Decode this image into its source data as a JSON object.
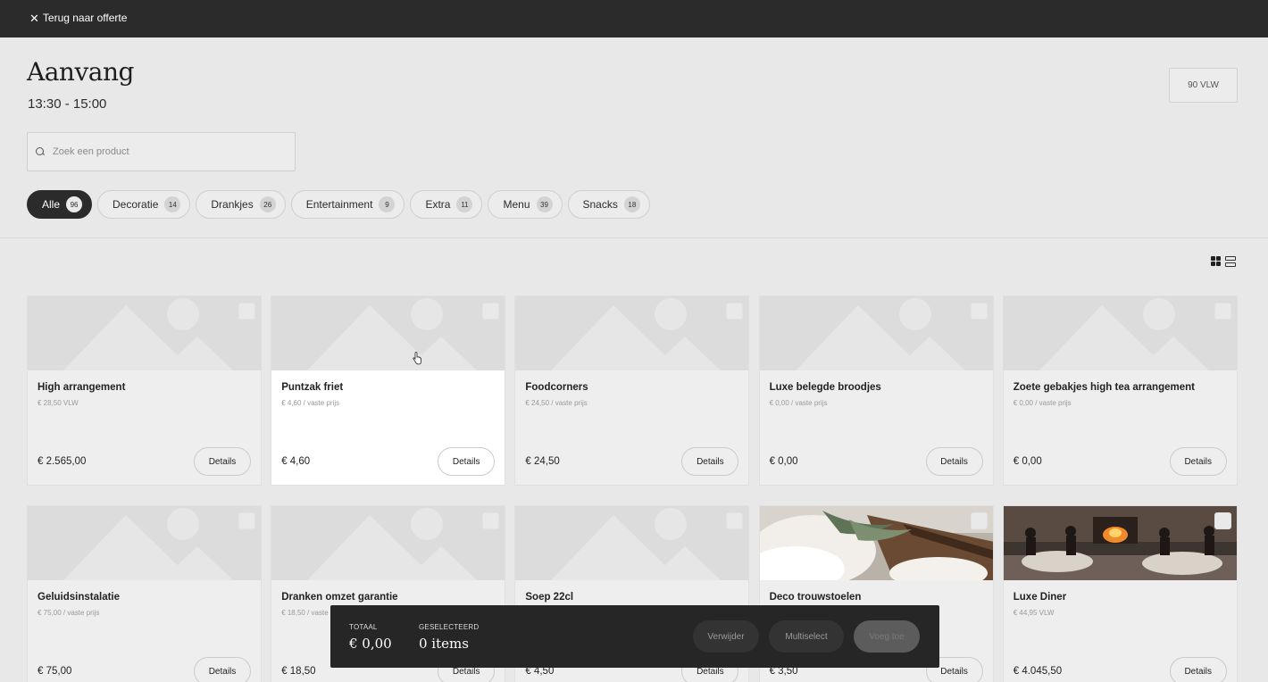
{
  "topbar": {
    "back_label": "Terug naar offerte"
  },
  "header": {
    "title": "Aanvang",
    "time": "13:30 - 15:00",
    "guests": "90 VLW"
  },
  "search": {
    "placeholder": "Zoek een product"
  },
  "filters": [
    {
      "label": "Alle",
      "count": "96",
      "active": true
    },
    {
      "label": "Decoratie",
      "count": "14",
      "active": false
    },
    {
      "label": "Drankjes",
      "count": "26",
      "active": false
    },
    {
      "label": "Entertainment",
      "count": "9",
      "active": false
    },
    {
      "label": "Extra",
      "count": "11",
      "active": false
    },
    {
      "label": "Menu",
      "count": "39",
      "active": false
    },
    {
      "label": "Snacks",
      "count": "18",
      "active": false
    }
  ],
  "products": [
    {
      "name": "High arrangement",
      "sub": "€ 28,50 VLW",
      "price": "€ 2.565,00",
      "details": "Details",
      "image": "placeholder",
      "hover": false
    },
    {
      "name": "Puntzak friet",
      "sub": "€ 4,60 / vaste prijs",
      "price": "€ 4,60",
      "details": "Details",
      "image": "placeholder",
      "hover": true
    },
    {
      "name": "Foodcorners",
      "sub": "€ 24,50 / vaste prijs",
      "price": "€ 24,50",
      "details": "Details",
      "image": "placeholder",
      "hover": false
    },
    {
      "name": "Luxe belegde broodjes",
      "sub": "€ 0,00 / vaste prijs",
      "price": "€ 0,00",
      "details": "Details",
      "image": "placeholder",
      "hover": false
    },
    {
      "name": "Zoete gebakjes high tea arrangement",
      "sub": "€ 0,00 / vaste prijs",
      "price": "€ 0,00",
      "details": "Details",
      "image": "placeholder",
      "hover": false
    },
    {
      "name": "Geluidsinstalatie",
      "sub": "€ 75,00 / vaste prijs",
      "price": "€ 75,00",
      "details": "Details",
      "image": "placeholder",
      "hover": false
    },
    {
      "name": "Dranken omzet garantie",
      "sub": "€ 18,50 / vaste prijs",
      "price": "€ 18,50",
      "details": "Details",
      "image": "placeholder",
      "hover": false
    },
    {
      "name": "Soep 22cl",
      "sub": "",
      "price": "€ 4,50",
      "details": "Details",
      "image": "placeholder",
      "hover": false
    },
    {
      "name": "Deco trouwstoelen",
      "sub": "",
      "price": "€ 3,50",
      "details": "Details",
      "image": "chairs-photo",
      "hover": false
    },
    {
      "name": "Luxe Diner",
      "sub": "€ 44,95 VLW",
      "price": "€ 4.045,50",
      "details": "Details",
      "image": "dinner-photo",
      "hover": false
    }
  ],
  "summary": {
    "total_label": "TOTAAL",
    "total_value": "€ 0,00",
    "selected_label": "GESELECTEERD",
    "selected_value": "0 items",
    "remove_label": "Verwijder",
    "multiselect_label": "Multiselect",
    "add_label": "Voeg toe"
  }
}
